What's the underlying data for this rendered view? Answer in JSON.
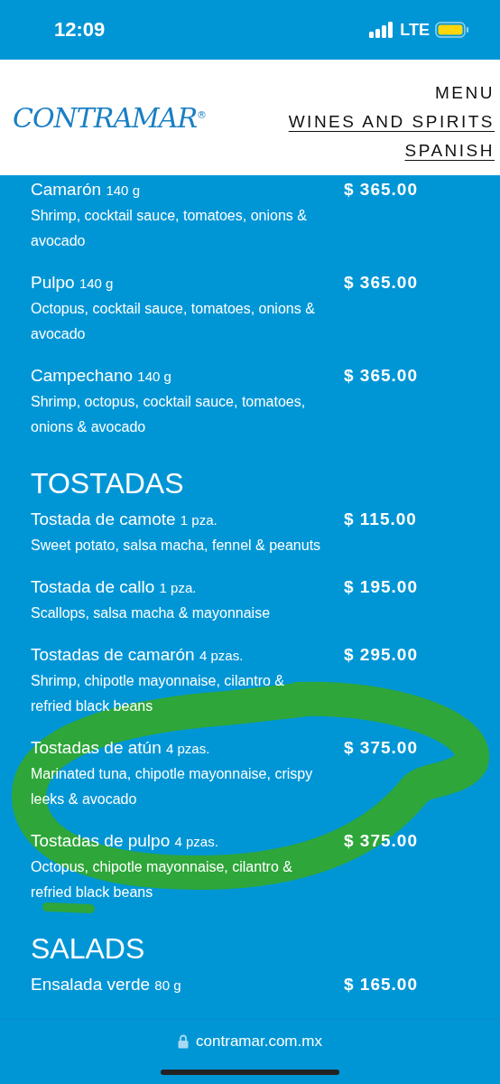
{
  "status_bar": {
    "time": "12:09",
    "network": "LTE"
  },
  "header": {
    "logo": "CONTRAMAR",
    "logo_mark": "®",
    "nav": [
      {
        "label": "MENU",
        "selected": true
      },
      {
        "label": "WINES AND SPIRITS",
        "selected": false
      },
      {
        "label": "SPANISH",
        "selected": false
      }
    ]
  },
  "sections": [
    {
      "items": [
        {
          "name": "Camarón",
          "portion": "140 g",
          "price": "$ 365.00",
          "description": "Shrimp, cocktail sauce, tomatoes, onions & avocado"
        },
        {
          "name": "Pulpo",
          "portion": "140 g",
          "price": "$ 365.00",
          "description": "Octopus, cocktail sauce, tomatoes, onions & avocado"
        },
        {
          "name": "Campechano",
          "portion": "140 g",
          "price": "$ 365.00",
          "description": "Shrimp, octopus, cocktail sauce, tomatoes, onions & avocado"
        }
      ]
    },
    {
      "title": "TOSTADAS",
      "items": [
        {
          "name": "Tostada de camote",
          "portion": "1 pza.",
          "price": "$ 115.00",
          "description": "Sweet potato, salsa macha, fennel & peanuts"
        },
        {
          "name": "Tostada de callo",
          "portion": "1 pza.",
          "price": "$ 195.00",
          "description": "Scallops, salsa macha & mayonnaise"
        },
        {
          "name": "Tostadas de camarón",
          "portion": "4 pzas.",
          "price": "$ 295.00",
          "description": "Shrimp, chipotle mayonnaise, cilantro & refried black beans"
        },
        {
          "name": "Tostadas de atún",
          "portion": "4 pzas.",
          "price": "$ 375.00",
          "description": "Marinated tuna, chipotle mayonnaise, crispy leeks & avocado"
        },
        {
          "name": "Tostadas de pulpo",
          "portion": "4 pzas.",
          "price": "$ 375.00",
          "description": "Octopus, chipotle mayonnaise, cilantro & refried black beans"
        }
      ]
    },
    {
      "title": "SALADS",
      "items": [
        {
          "name": "Ensalada verde",
          "portion": "80 g",
          "price": "$ 165.00"
        }
      ]
    }
  ],
  "address_bar": {
    "url": "contramar.com.mx"
  }
}
